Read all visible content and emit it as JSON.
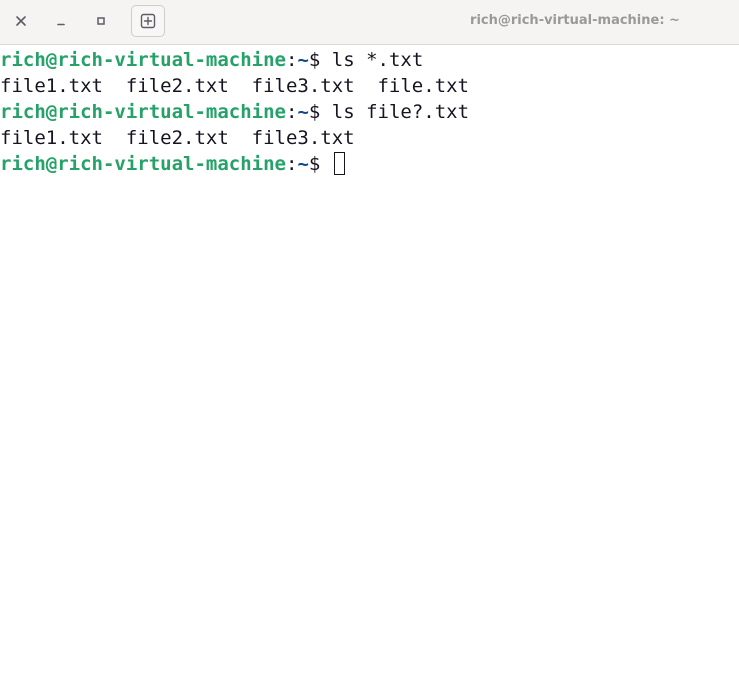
{
  "window": {
    "title": "rich@rich-virtual-machine: ~"
  },
  "terminal": {
    "prompt_user": "rich@rich-virtual-machine",
    "prompt_colon": ":",
    "prompt_path": "~",
    "prompt_dollar": "$ ",
    "lines": [
      {
        "type": "prompt",
        "command": "ls *.txt"
      },
      {
        "type": "output",
        "text": "file1.txt  file2.txt  file3.txt  file.txt"
      },
      {
        "type": "prompt",
        "command": "ls file?.txt"
      },
      {
        "type": "output",
        "text": "file1.txt  file2.txt  file3.txt"
      },
      {
        "type": "prompt",
        "command": ""
      }
    ]
  },
  "icons": {
    "close": "close-icon",
    "minimize": "minimize-icon",
    "maximize": "maximize-icon",
    "new_tab": "new-tab-icon"
  },
  "colors": {
    "prompt_user": "#26a269",
    "prompt_path": "#12488b",
    "text": "#171421",
    "titlebar": "#f5f4f3"
  }
}
